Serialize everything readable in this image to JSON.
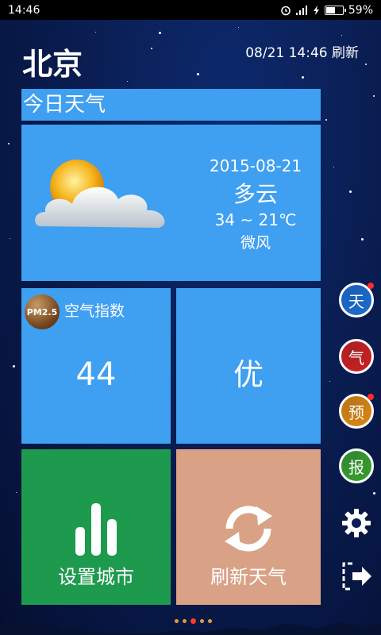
{
  "status_bar": {
    "time": "14:46",
    "battery": "59%",
    "battery_level": 0.59
  },
  "header": {
    "city": "北京",
    "update_time": "08/21 14:46 刷新"
  },
  "today": {
    "title": "今日天气",
    "date": "2015-08-21",
    "condition": "多云",
    "temperature": "34 ~ 21℃",
    "wind": "微风",
    "icon": "partly-cloudy-icon"
  },
  "air": {
    "badge": "PM2.5",
    "label": "空气指数",
    "value": "44",
    "quality": "优"
  },
  "actions": {
    "set_city": "设置城市",
    "refresh": "刷新天气"
  },
  "side_menu": [
    {
      "label": "天",
      "color": "#1d6fd0",
      "has_dot": true
    },
    {
      "label": "气",
      "color": "#d0201e",
      "has_dot": false
    },
    {
      "label": "预",
      "color": "#e08a10",
      "has_dot": true
    },
    {
      "label": "报",
      "color": "#3aa22a",
      "has_dot": false
    }
  ],
  "pager": {
    "count": 5,
    "active": 2
  }
}
